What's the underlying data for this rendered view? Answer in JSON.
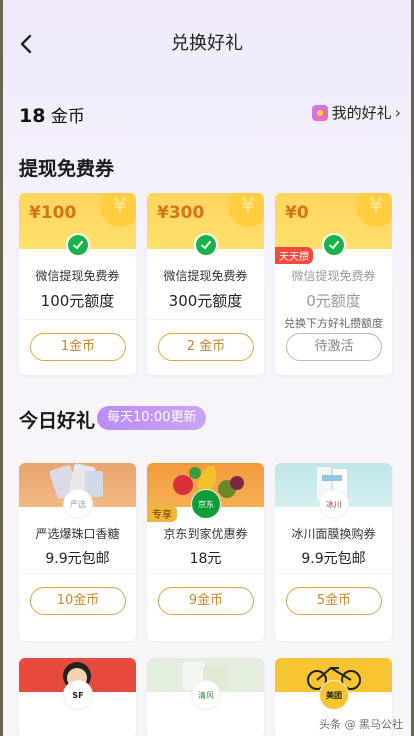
{
  "header": {
    "title": "兑换好礼"
  },
  "balance": {
    "amount": "18",
    "unit": "金币"
  },
  "my_gifts": {
    "label": "我的好礼"
  },
  "sections": {
    "vouchers_title": "提现免费券",
    "today_title": "今日好礼",
    "today_badge": "每天10:00更新"
  },
  "vouchers": [
    {
      "amount": "¥100",
      "name": "微信提现免费券",
      "quota": "100元额度",
      "button": "1金币"
    },
    {
      "amount": "¥300",
      "name": "微信提现免费券",
      "quota": "300元额度",
      "button": "2 金币"
    },
    {
      "amount": "¥0",
      "name": "微信提现免费券",
      "quota": "0元额度",
      "note": "兑换下方好礼攒额度",
      "button": "待激活",
      "tag": "天天攒"
    }
  ],
  "gifts": [
    {
      "name": "严选爆珠口香糖",
      "price": "9.9元包邮",
      "button": "10金币"
    },
    {
      "name": "京东到家优惠券",
      "price": "18元",
      "button": "9金币",
      "tag": "专享"
    },
    {
      "name": "冰川面膜换购券",
      "price": "9.9元包邮",
      "button": "5金币"
    }
  ],
  "bottom_row": [
    {
      "logo": "SF"
    },
    {
      "logo": "清风"
    },
    {
      "logo": "美团"
    }
  ],
  "watermark": "头条 @ 黑马公社",
  "colors": {
    "accent": "#d9a64a",
    "voucher_bg": "#ffd45c",
    "wechat": "#18b14a",
    "badge": "#b98cf7"
  }
}
